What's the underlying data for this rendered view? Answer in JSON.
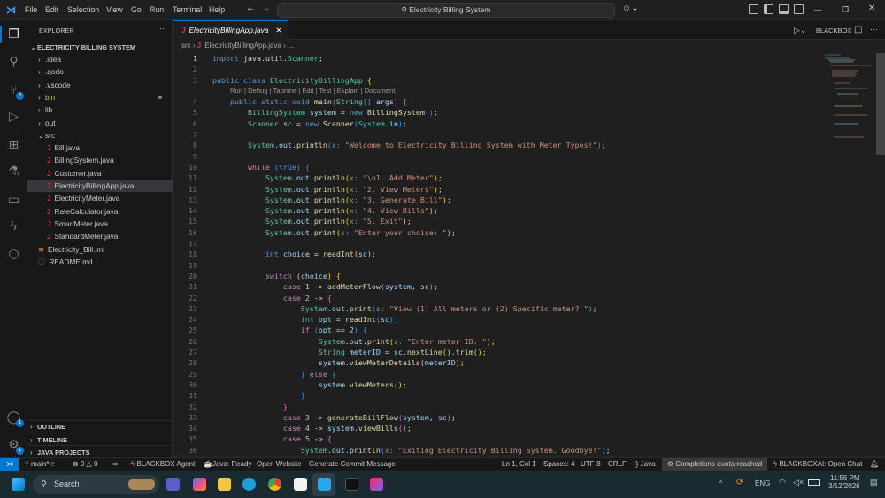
{
  "titlebar": {
    "menus": [
      "File",
      "Edit",
      "Selection",
      "View",
      "Go",
      "Run",
      "Terminal",
      "Help"
    ],
    "search": "Electricity Billing System"
  },
  "activity": {
    "scm_badge": "8",
    "accounts_badge": "1",
    "settings_badge": "1"
  },
  "sidebar": {
    "title": "EXPLORER",
    "more": "···",
    "project": "ELECTRICITY BILLING SYSTEM",
    "items": [
      {
        "label": ".idea",
        "type": "folder",
        "depth": 1
      },
      {
        "label": ".qodo",
        "type": "folder",
        "depth": 1
      },
      {
        "label": ".vscode",
        "type": "folder",
        "depth": 1
      },
      {
        "label": "bin",
        "type": "folder",
        "depth": 1,
        "color": "#c5c36b"
      },
      {
        "label": "lib",
        "type": "folder",
        "depth": 1
      },
      {
        "label": "out",
        "type": "folder",
        "depth": 1
      },
      {
        "label": "src",
        "type": "folder-open",
        "depth": 1
      },
      {
        "label": "Bill.java",
        "type": "java",
        "depth": 2
      },
      {
        "label": "BillingSystem.java",
        "type": "java",
        "depth": 2
      },
      {
        "label": "Customer.java",
        "type": "java",
        "depth": 2
      },
      {
        "label": "ElectricityBillingApp.java",
        "type": "java",
        "depth": 2,
        "selected": true
      },
      {
        "label": "ElectricityMeter.java",
        "type": "java",
        "depth": 2
      },
      {
        "label": "RateCalculator.java",
        "type": "java",
        "depth": 2
      },
      {
        "label": "SmartMeter.java",
        "type": "java",
        "depth": 2
      },
      {
        "label": "StandardMeter.java",
        "type": "java",
        "depth": 2
      },
      {
        "label": "Electricity_Bill.iml",
        "type": "iml",
        "depth": 1
      },
      {
        "label": "README.md",
        "type": "md",
        "depth": 1
      }
    ],
    "sections": [
      "OUTLINE",
      "TIMELINE",
      "JAVA PROJECTS"
    ]
  },
  "editor": {
    "tab": "ElectricityBillingApp.java",
    "breadcrumb": [
      "src",
      "ElectricityBillingApp.java",
      "..."
    ],
    "run_label": "BLACKBOX",
    "codelens": "Run | Debug | Tabnine | Edit | Test | Explain | Document",
    "lines": [
      [
        [
          "kw",
          "import "
        ],
        [
          "pl",
          "java.util."
        ],
        [
          "ty",
          "Scanner"
        ],
        [
          "pl",
          ";"
        ]
      ],
      [],
      [
        [
          "kw",
          "public class "
        ],
        [
          "ty",
          "ElectricityBillingApp "
        ],
        [
          "br1",
          "{"
        ]
      ],
      [
        [
          "kw",
          "    public static void "
        ],
        [
          "fn",
          "main"
        ],
        [
          "br2",
          "("
        ],
        [
          "ty",
          "String"
        ],
        [
          "br3",
          "[]"
        ],
        [
          "var",
          " args"
        ],
        [
          "br2",
          ")"
        ],
        [
          "pl",
          " "
        ],
        [
          "br2",
          "{"
        ]
      ],
      [
        [
          "ty",
          "        BillingSystem "
        ],
        [
          "var",
          "system"
        ],
        [
          "pl",
          " = "
        ],
        [
          "kw",
          "new "
        ],
        [
          "fn",
          "BillingSystem"
        ],
        [
          "br3",
          "()"
        ],
        [
          "pl",
          ";"
        ]
      ],
      [
        [
          "ty",
          "        Scanner "
        ],
        [
          "var",
          "sc"
        ],
        [
          "pl",
          " = "
        ],
        [
          "kw",
          "new "
        ],
        [
          "fn",
          "Scanner"
        ],
        [
          "br3",
          "("
        ],
        [
          "ty",
          "System"
        ],
        [
          "pl",
          "."
        ],
        [
          "var",
          "in"
        ],
        [
          "br3",
          ")"
        ],
        [
          "pl",
          ";"
        ]
      ],
      [],
      [
        [
          "ty",
          "        System"
        ],
        [
          "pl",
          "."
        ],
        [
          "var",
          "out"
        ],
        [
          "pl",
          "."
        ],
        [
          "fn",
          "println"
        ],
        [
          "br3",
          "("
        ],
        [
          "hint",
          "x: "
        ],
        [
          "str",
          "\"Welcome to Electricity Billing System with Meter Types!\""
        ],
        [
          "br3",
          ")"
        ],
        [
          "pl",
          ";"
        ]
      ],
      [],
      [
        [
          "ctl",
          "        while "
        ],
        [
          "br3",
          "("
        ],
        [
          "kw",
          "true"
        ],
        [
          "br3",
          ")"
        ],
        [
          "pl",
          " "
        ],
        [
          "br3",
          "{"
        ]
      ],
      [
        [
          "ty",
          "            System"
        ],
        [
          "pl",
          "."
        ],
        [
          "var",
          "out"
        ],
        [
          "pl",
          "."
        ],
        [
          "fn",
          "println"
        ],
        [
          "br1",
          "("
        ],
        [
          "hint",
          "x: "
        ],
        [
          "str",
          "\"\\n1. Add Meter\""
        ],
        [
          "br1",
          ")"
        ],
        [
          "pl",
          ";"
        ]
      ],
      [
        [
          "ty",
          "            System"
        ],
        [
          "pl",
          "."
        ],
        [
          "var",
          "out"
        ],
        [
          "pl",
          "."
        ],
        [
          "fn",
          "println"
        ],
        [
          "br1",
          "("
        ],
        [
          "hint",
          "x: "
        ],
        [
          "str",
          "\"2. View Meters\""
        ],
        [
          "br1",
          ")"
        ],
        [
          "pl",
          ";"
        ]
      ],
      [
        [
          "ty",
          "            System"
        ],
        [
          "pl",
          "."
        ],
        [
          "var",
          "out"
        ],
        [
          "pl",
          "."
        ],
        [
          "fn",
          "println"
        ],
        [
          "br1",
          "("
        ],
        [
          "hint",
          "x: "
        ],
        [
          "str",
          "\"3. Generate Bill\""
        ],
        [
          "br1",
          ")"
        ],
        [
          "pl",
          ";"
        ]
      ],
      [
        [
          "ty",
          "            System"
        ],
        [
          "pl",
          "."
        ],
        [
          "var",
          "out"
        ],
        [
          "pl",
          "."
        ],
        [
          "fn",
          "println"
        ],
        [
          "br1",
          "("
        ],
        [
          "hint",
          "x: "
        ],
        [
          "str",
          "\"4. View Bills\""
        ],
        [
          "br1",
          ")"
        ],
        [
          "pl",
          ";"
        ]
      ],
      [
        [
          "ty",
          "            System"
        ],
        [
          "pl",
          "."
        ],
        [
          "var",
          "out"
        ],
        [
          "pl",
          "."
        ],
        [
          "fn",
          "println"
        ],
        [
          "br1",
          "("
        ],
        [
          "hint",
          "x: "
        ],
        [
          "str",
          "\"5. Exit\""
        ],
        [
          "br1",
          ")"
        ],
        [
          "pl",
          ";"
        ]
      ],
      [
        [
          "ty",
          "            System"
        ],
        [
          "pl",
          "."
        ],
        [
          "var",
          "out"
        ],
        [
          "pl",
          "."
        ],
        [
          "fn",
          "print"
        ],
        [
          "br1",
          "("
        ],
        [
          "hint",
          "s: "
        ],
        [
          "str",
          "\"Enter your choice: \""
        ],
        [
          "br1",
          ")"
        ],
        [
          "pl",
          ";"
        ]
      ],
      [],
      [
        [
          "kw",
          "            int "
        ],
        [
          "var",
          "choice"
        ],
        [
          "pl",
          " = "
        ],
        [
          "fn",
          "readInt"
        ],
        [
          "br1",
          "("
        ],
        [
          "var",
          "sc"
        ],
        [
          "br1",
          ")"
        ],
        [
          "pl",
          ";"
        ]
      ],
      [],
      [
        [
          "ctl",
          "            switch "
        ],
        [
          "br1",
          "("
        ],
        [
          "var",
          "choice"
        ],
        [
          "br1",
          ")"
        ],
        [
          "pl",
          " "
        ],
        [
          "br1",
          "{"
        ]
      ],
      [
        [
          "ctl",
          "                case "
        ],
        [
          "num2",
          "1"
        ],
        [
          "pl",
          " -> "
        ],
        [
          "fn",
          "addMeterFlow"
        ],
        [
          "br2",
          "("
        ],
        [
          "var",
          "system"
        ],
        [
          "pl",
          ", "
        ],
        [
          "var",
          "sc"
        ],
        [
          "br2",
          ")"
        ],
        [
          "pl",
          ";"
        ]
      ],
      [
        [
          "ctl",
          "                case "
        ],
        [
          "num2",
          "2"
        ],
        [
          "pl",
          " -> "
        ],
        [
          "br2",
          "{"
        ]
      ],
      [
        [
          "ty",
          "                    System"
        ],
        [
          "pl",
          "."
        ],
        [
          "var",
          "out"
        ],
        [
          "pl",
          "."
        ],
        [
          "fn",
          "print"
        ],
        [
          "br3",
          "("
        ],
        [
          "hint",
          "s: "
        ],
        [
          "str",
          "\"View (1) All meters or (2) Specific meter? \""
        ],
        [
          "br3",
          ")"
        ],
        [
          "pl",
          ";"
        ]
      ],
      [
        [
          "kw",
          "                    int "
        ],
        [
          "var",
          "opt"
        ],
        [
          "pl",
          " = "
        ],
        [
          "fn",
          "readInt"
        ],
        [
          "br3",
          "("
        ],
        [
          "var",
          "sc"
        ],
        [
          "br3",
          ")"
        ],
        [
          "pl",
          ";"
        ]
      ],
      [
        [
          "ctl",
          "                    if "
        ],
        [
          "br3",
          "("
        ],
        [
          "var",
          "opt"
        ],
        [
          "pl",
          " == "
        ],
        [
          "num2",
          "2"
        ],
        [
          "br3",
          ")"
        ],
        [
          "pl",
          " "
        ],
        [
          "br3",
          "{"
        ]
      ],
      [
        [
          "ty",
          "                        System"
        ],
        [
          "pl",
          "."
        ],
        [
          "var",
          "out"
        ],
        [
          "pl",
          "."
        ],
        [
          "fn",
          "print"
        ],
        [
          "br1",
          "("
        ],
        [
          "hint",
          "s: "
        ],
        [
          "str",
          "\"Enter meter ID: \""
        ],
        [
          "br1",
          ")"
        ],
        [
          "pl",
          ";"
        ]
      ],
      [
        [
          "ty",
          "                        String "
        ],
        [
          "var",
          "meterID"
        ],
        [
          "pl",
          " = "
        ],
        [
          "var",
          "sc"
        ],
        [
          "pl",
          "."
        ],
        [
          "fn",
          "nextLine"
        ],
        [
          "br1",
          "()"
        ],
        [
          "pl",
          "."
        ],
        [
          "fn",
          "trim"
        ],
        [
          "br1",
          "()"
        ],
        [
          "pl",
          ";"
        ]
      ],
      [
        [
          "var",
          "                        system"
        ],
        [
          "pl",
          "."
        ],
        [
          "fn",
          "viewMeterDetails"
        ],
        [
          "br1",
          "("
        ],
        [
          "var",
          "meterID"
        ],
        [
          "br1",
          ")"
        ],
        [
          "pl",
          ";"
        ]
      ],
      [
        [
          "br3",
          "                    }"
        ],
        [
          "ctl",
          " else "
        ],
        [
          "br3",
          "{"
        ]
      ],
      [
        [
          "var",
          "                        system"
        ],
        [
          "pl",
          "."
        ],
        [
          "fn",
          "viewMeters"
        ],
        [
          "br1",
          "()"
        ],
        [
          "pl",
          ";"
        ]
      ],
      [
        [
          "br3",
          "                    }"
        ]
      ],
      [
        [
          "br2",
          "                }"
        ]
      ],
      [
        [
          "ctl",
          "                case "
        ],
        [
          "num2",
          "3"
        ],
        [
          "pl",
          " -> "
        ],
        [
          "fn",
          "generateBillFlow"
        ],
        [
          "br2",
          "("
        ],
        [
          "var",
          "system"
        ],
        [
          "pl",
          ", "
        ],
        [
          "var",
          "sc"
        ],
        [
          "br2",
          ")"
        ],
        [
          "pl",
          ";"
        ]
      ],
      [
        [
          "ctl",
          "                case "
        ],
        [
          "num2",
          "4"
        ],
        [
          "pl",
          " -> "
        ],
        [
          "var",
          "system"
        ],
        [
          "pl",
          "."
        ],
        [
          "fn",
          "viewBills"
        ],
        [
          "br2",
          "()"
        ],
        [
          "pl",
          ";"
        ]
      ],
      [
        [
          "ctl",
          "                case "
        ],
        [
          "num2",
          "5"
        ],
        [
          "pl",
          " -> "
        ],
        [
          "br2",
          "{"
        ]
      ],
      [
        [
          "ty",
          "                    System"
        ],
        [
          "pl",
          "."
        ],
        [
          "var",
          "out"
        ],
        [
          "pl",
          "."
        ],
        [
          "fn",
          "println"
        ],
        [
          "br3",
          "("
        ],
        [
          "hint",
          "x: "
        ],
        [
          "str",
          "\"Exiting Electricity Billing System. Goodbye!\""
        ],
        [
          "br3",
          ")"
        ],
        [
          "pl",
          ";"
        ]
      ]
    ]
  },
  "status": {
    "branch": "main*",
    "errors": "0",
    "warnings": "0",
    "blackbox_agent": "BLACKBOX Agent",
    "java": "Java: Ready",
    "open_website": "Open Website",
    "commit_msg": "Generate Commit Message",
    "position": "Ln 1, Col 1",
    "spaces": "Spaces: 4",
    "encoding": "UTF-8",
    "eol": "CRLF",
    "language": "Java",
    "quota": "Completions quota reached",
    "chat": "BLACKBOXAI: Open Chat"
  },
  "taskbar": {
    "search": "Search",
    "lang": "ENG",
    "time": "11:56 PM",
    "date": "3/12/2026"
  },
  "colors": {
    "accent": "#0078d4",
    "java_icon": "#e0334a"
  }
}
